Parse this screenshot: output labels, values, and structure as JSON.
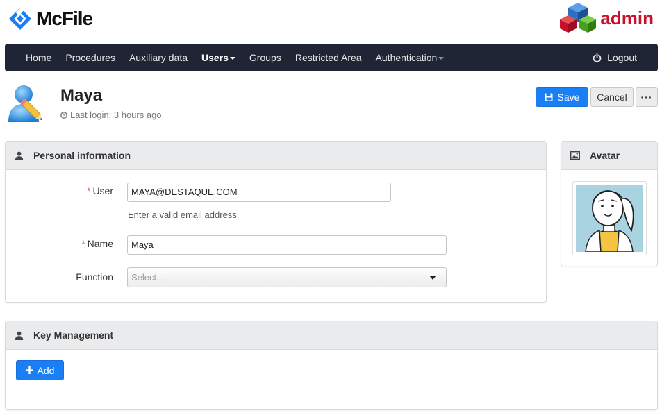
{
  "brand": {
    "name": "McFile",
    "admin_label": "admin"
  },
  "nav": {
    "items": [
      {
        "label": "Home"
      },
      {
        "label": "Procedures"
      },
      {
        "label": "Auxiliary data"
      },
      {
        "label": "Users"
      },
      {
        "label": "Groups"
      },
      {
        "label": "Restricted Area"
      },
      {
        "label": "Authentication"
      }
    ],
    "logout_label": "Logout"
  },
  "page": {
    "title": "Maya",
    "last_login": "Last login: 3 hours ago",
    "save_label": "Save",
    "cancel_label": "Cancel",
    "more_label": "···"
  },
  "personal": {
    "title": "Personal information",
    "user_label": "User",
    "user_value": "MAYA@DESTAQUE.COM",
    "user_help": "Enter a valid email address.",
    "name_label": "Name",
    "name_value": "Maya",
    "function_label": "Function",
    "function_placeholder": "Select...",
    "required_mark": "*"
  },
  "avatar": {
    "title": "Avatar"
  },
  "keys": {
    "title": "Key Management",
    "add_label": "Add"
  },
  "colors": {
    "navbar": "#1f2534",
    "primary": "#1a7ff5",
    "brand_blue": "#1a7ff5",
    "admin_red": "#c8102e"
  },
  "icons": [
    "mcfile-logo-icon",
    "admin-cubes-icon",
    "caret-down-icon",
    "power-icon",
    "user-edit-icon",
    "clock-icon",
    "floppy-disk-icon",
    "user-icon",
    "image-icon",
    "plus-icon"
  ]
}
